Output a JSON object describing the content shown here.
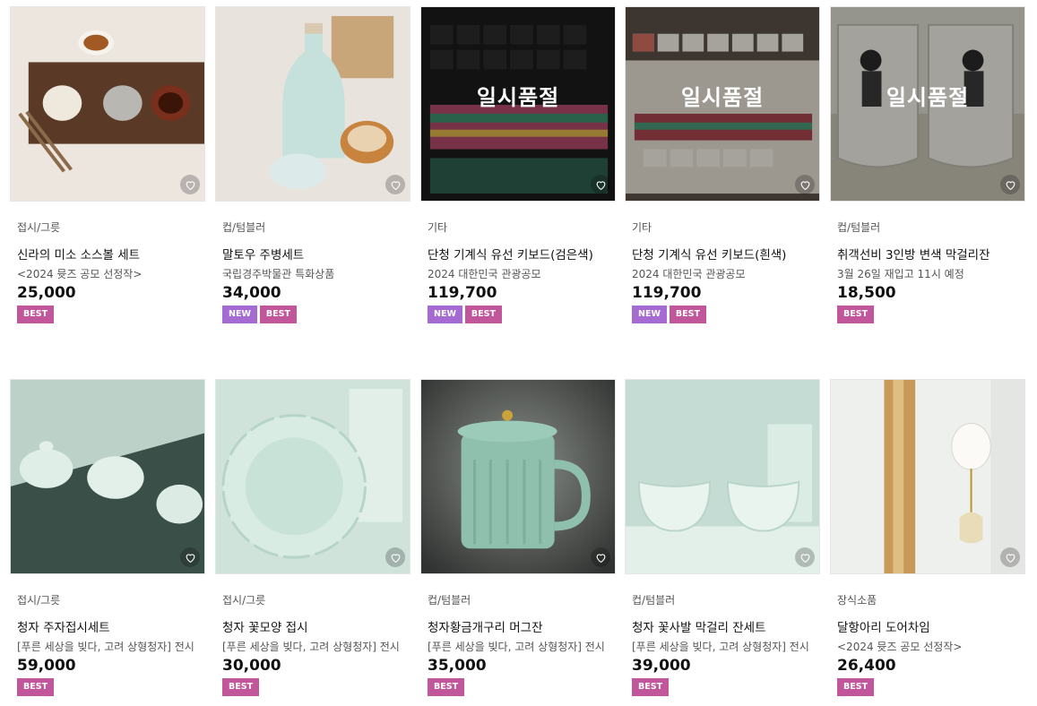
{
  "products": [
    {
      "category": "접시/그릇",
      "name": "신라의 미소 소스볼 세트",
      "sub": "<2024 뮷즈 공모 선정작>",
      "price": "25,000",
      "badges": [
        "BEST"
      ],
      "soldout": "",
      "heart": "heart-icon"
    },
    {
      "category": "컵/텀블러",
      "name": "말토우 주병세트",
      "sub": "국립경주박물관 특화상품",
      "price": "34,000",
      "badges": [
        "NEW",
        "BEST"
      ],
      "soldout": "",
      "heart": "heart-icon"
    },
    {
      "category": "기타",
      "name": "단청 기계식 유선 키보드(검은색)",
      "sub": "2024 대한민국 관광공모",
      "price": "119,700",
      "badges": [
        "NEW",
        "BEST"
      ],
      "soldout": "일시품절",
      "heart": "heart-icon"
    },
    {
      "category": "기타",
      "name": "단청 기계식 유선 키보드(흰색)",
      "sub": "2024 대한민국 관광공모",
      "price": "119,700",
      "badges": [
        "NEW",
        "BEST"
      ],
      "soldout": "일시품절",
      "heart": "heart-icon"
    },
    {
      "category": "컵/텀블러",
      "name": "취객선비 3인방 변색 막걸리잔",
      "sub": "3월 26일 재입고 11시 예정",
      "price": "18,500",
      "badges": [
        "BEST"
      ],
      "soldout": "일시품절",
      "heart": "heart-icon"
    },
    {
      "category": "접시/그릇",
      "name": "청자 주자접시세트",
      "sub": "[푸른 세상을 빚다, 고려 상형청자] 전시",
      "price": "59,000",
      "badges": [
        "BEST"
      ],
      "soldout": "",
      "heart": "heart-icon"
    },
    {
      "category": "접시/그릇",
      "name": "청자 꽃모양 접시",
      "sub": "[푸른 세상을 빚다, 고려 상형청자] 전시",
      "price": "30,000",
      "badges": [
        "BEST"
      ],
      "soldout": "",
      "heart": "heart-icon"
    },
    {
      "category": "컵/텀블러",
      "name": "청자황금개구리 머그잔",
      "sub": "[푸른 세상을 빚다, 고려 상형청자] 전시",
      "price": "35,000",
      "badges": [
        "BEST"
      ],
      "soldout": "",
      "heart": "heart-icon"
    },
    {
      "category": "컵/텀블러",
      "name": "청자 꽃사발 막걸리 잔세트",
      "sub": "[푸른 세상을 빚다, 고려 상형청자] 전시",
      "price": "39,000",
      "badges": [
        "BEST"
      ],
      "soldout": "",
      "heart": "heart-icon"
    },
    {
      "category": "장식소품",
      "name": "달항아리 도어차임",
      "sub": "<2024 뮷즈 공모 선정작>",
      "price": "26,400",
      "badges": [
        "BEST"
      ],
      "soldout": "",
      "heart": "heart-icon"
    }
  ],
  "colors": {
    "best": "#c2569a",
    "new": "#a56bd2"
  }
}
